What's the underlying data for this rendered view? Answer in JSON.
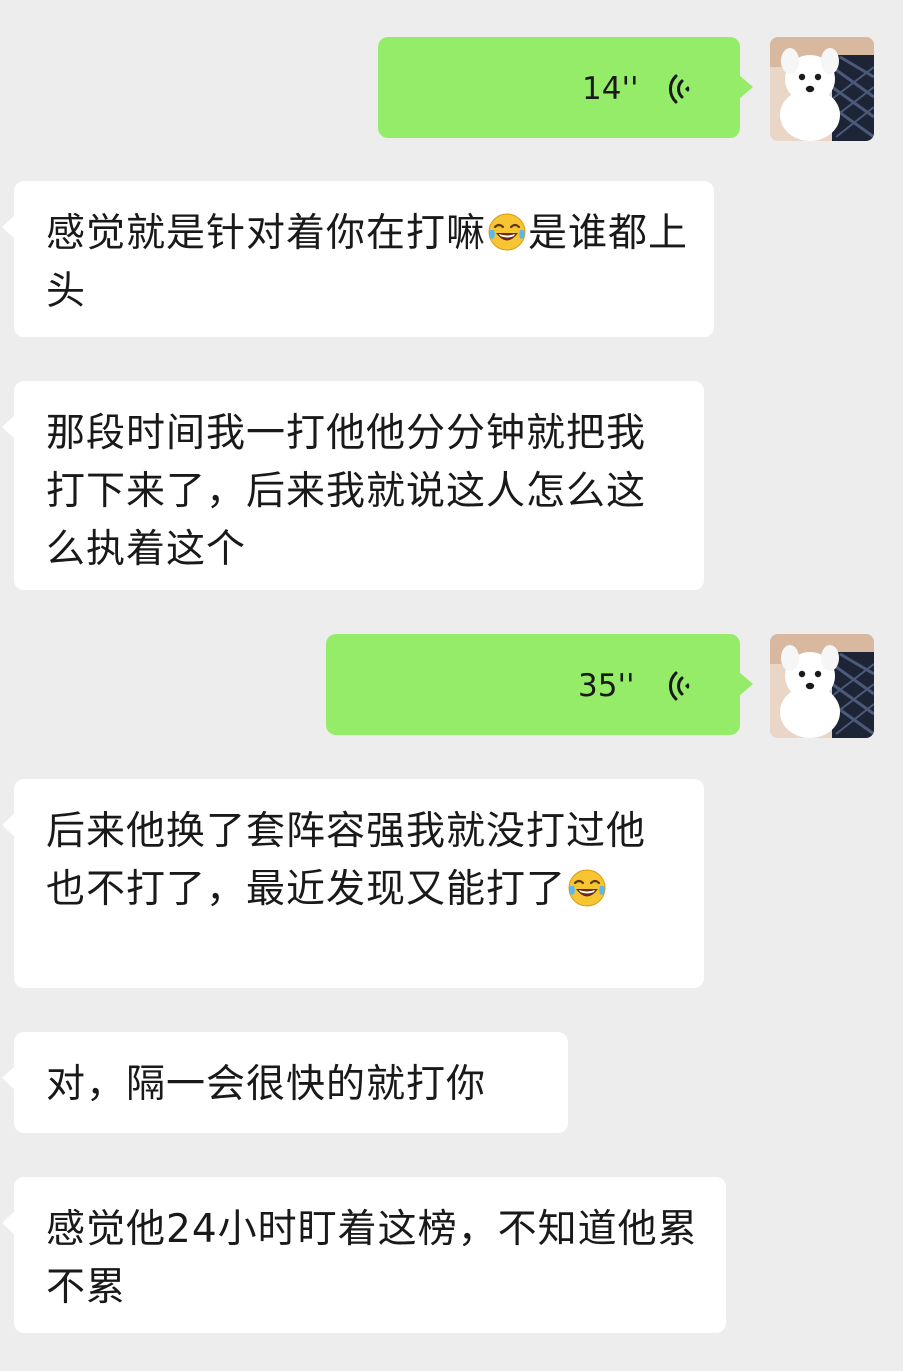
{
  "messages": [
    {
      "type": "voice",
      "side": "out",
      "duration": "14''"
    },
    {
      "type": "text",
      "side": "in",
      "text_a": "感觉就是针对着你在打嘛",
      "emoji": "tears-of-joy",
      "text_b": "是谁都上头"
    },
    {
      "type": "text",
      "side": "in",
      "text": "那段时间我一打他他分分钟就把我打下来了，后来我就说这人怎么这么执着这个"
    },
    {
      "type": "voice",
      "side": "out",
      "duration": "35''"
    },
    {
      "type": "text",
      "side": "in",
      "text": "后来他换了套阵容强我就没打过他也不打了，最近发现又能打了",
      "emoji": "tears-of-joy"
    },
    {
      "type": "text",
      "side": "in",
      "text": "对，隔一会很快的就打你"
    },
    {
      "type": "text",
      "side": "in",
      "text": "感觉他24小时盯着这榜，不知道他累不累"
    }
  ],
  "avatar": {
    "description": "white-puppy-photo"
  },
  "colors": {
    "background": "#ededed",
    "incoming_bubble": "#ffffff",
    "outgoing_bubble": "#95ec69",
    "text": "#191919"
  }
}
